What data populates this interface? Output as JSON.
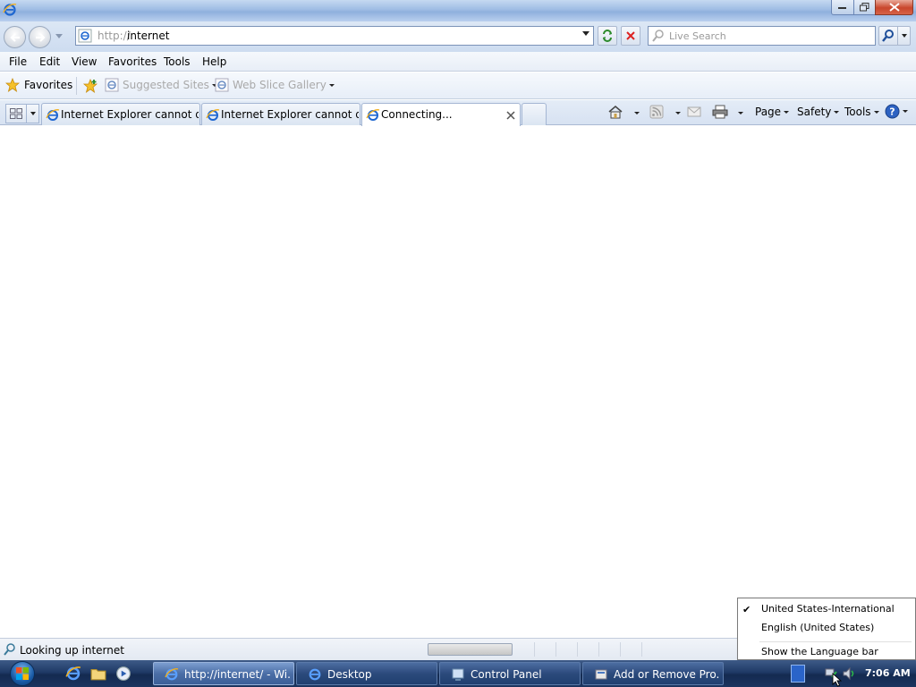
{
  "window": {
    "minimize_label": "minimize",
    "maximize_label": "restore",
    "close_label": "close"
  },
  "address_bar": {
    "prefix": "http://",
    "value": "internet"
  },
  "search": {
    "placeholder": "Live Search"
  },
  "menu": [
    "File",
    "Edit",
    "View",
    "Favorites",
    "Tools",
    "Help"
  ],
  "favorites_bar": {
    "favorites_label": "Favorites",
    "suggested_sites": "Suggested Sites",
    "web_slice_gallery": "Web Slice Gallery"
  },
  "tabs": [
    {
      "label": "Internet Explorer cannot dis..."
    },
    {
      "label": "Internet Explorer cannot dis..."
    },
    {
      "label": "Connecting..."
    }
  ],
  "command_bar": {
    "page": "Page",
    "safety": "Safety",
    "tools": "Tools"
  },
  "status_bar": {
    "text": "Looking up internet"
  },
  "language_menu": {
    "items": [
      {
        "label": "United States-International",
        "checked": true
      },
      {
        "label": "English (United States)",
        "checked": false
      },
      {
        "label": "Show the Language bar",
        "checked": false
      }
    ]
  },
  "taskbar": {
    "tasks": [
      {
        "label": "http://internet/ - Wi...",
        "active": true
      },
      {
        "label": "Desktop",
        "active": false
      },
      {
        "label": "Control Panel",
        "active": false
      },
      {
        "label": "Add or Remove Pro...",
        "active": false
      }
    ],
    "clock": "7:06 AM"
  },
  "colors": {
    "accent": "#1e5bb8",
    "ie_blue": "#2a6ad6",
    "taskbar": "#1f3a66"
  }
}
